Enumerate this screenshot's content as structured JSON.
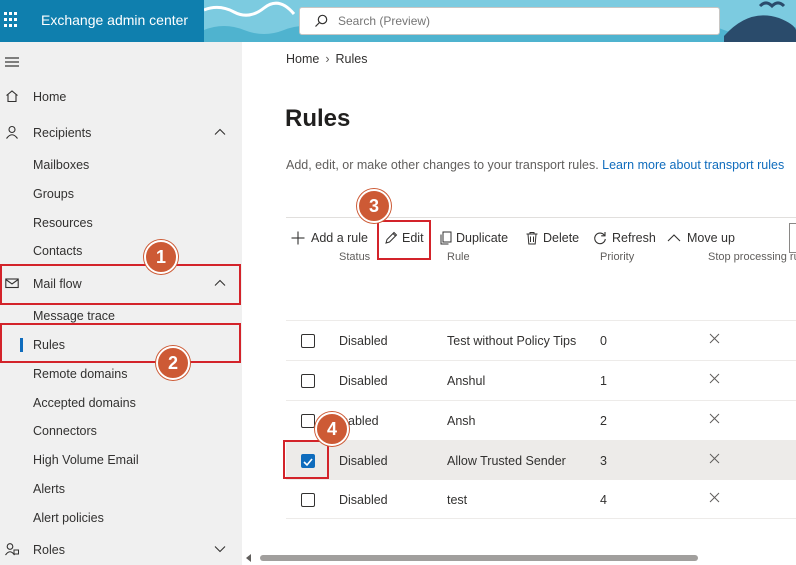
{
  "header": {
    "app_title": "Exchange admin center",
    "search_placeholder": "Search (Preview)",
    "icons": [
      "waffle-icon",
      "search-icon"
    ],
    "colors": {
      "brand": "#0f7fae",
      "banner": "#7ccbe0",
      "accent": "#0f6cbd",
      "callout": "#d3232a",
      "badge": "#cd5a35"
    }
  },
  "sidebar": {
    "items": [
      {
        "label": "Home",
        "icon": "home-icon"
      },
      {
        "label": "Recipients",
        "icon": "person-icon",
        "expanded": true
      },
      {
        "label": "Mailboxes"
      },
      {
        "label": "Groups"
      },
      {
        "label": "Resources"
      },
      {
        "label": "Contacts"
      },
      {
        "label": "Mail flow",
        "icon": "mail-icon",
        "expanded": true
      },
      {
        "label": "Message trace"
      },
      {
        "label": "Rules",
        "selected": true
      },
      {
        "label": "Remote domains"
      },
      {
        "label": "Accepted domains"
      },
      {
        "label": "Connectors"
      },
      {
        "label": "High Volume Email"
      },
      {
        "label": "Alerts"
      },
      {
        "label": "Alert policies"
      },
      {
        "label": "Roles",
        "icon": "roles-icon",
        "expanded": false
      }
    ]
  },
  "breadcrumb": {
    "home": "Home",
    "current": "Rules"
  },
  "page": {
    "title": "Rules",
    "description": "Add, edit, or make other changes to your transport rules.",
    "learn_more": "Learn more about transport rules"
  },
  "toolbar": {
    "add": "Add a rule",
    "edit": "Edit",
    "duplicate": "Duplicate",
    "delete": "Delete",
    "refresh": "Refresh",
    "move_up": "Move up"
  },
  "table": {
    "columns": [
      "Status",
      "Rule",
      "Priority",
      "Stop processing ru"
    ],
    "rows": [
      {
        "status": "Disabled",
        "rule": "Test without Policy Tips",
        "priority": "0",
        "stop": false,
        "checked": false
      },
      {
        "status": "Disabled",
        "rule": "Anshul",
        "priority": "1",
        "stop": false,
        "checked": false
      },
      {
        "status": "isabled",
        "rule": "Ansh",
        "priority": "2",
        "stop": false,
        "checked": false
      },
      {
        "status": "Disabled",
        "rule": "Allow Trusted Sender",
        "priority": "3",
        "stop": false,
        "checked": true
      },
      {
        "status": "Disabled",
        "rule": "test",
        "priority": "4",
        "stop": false,
        "checked": false
      }
    ]
  },
  "callouts": {
    "one": "1",
    "two": "2",
    "three": "3",
    "four": "4"
  },
  "scrollbar": {
    "horizontal_position": 0
  }
}
